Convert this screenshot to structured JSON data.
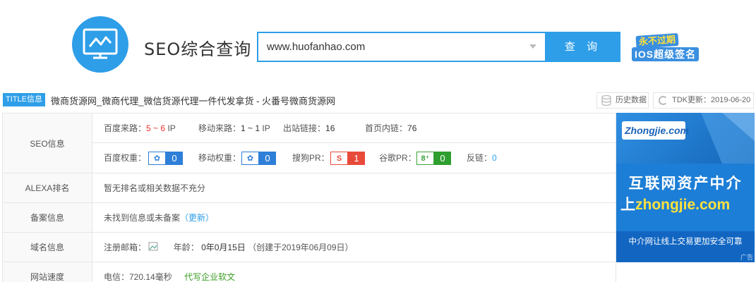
{
  "header": {
    "brand": "SEO综合查询",
    "search_value": "www.huofanhao.com",
    "search_button": "查 询",
    "ad_line1": "永不过期",
    "ad_line2": "IOS超级签名"
  },
  "title_row": {
    "tag": "TITLE信息",
    "title": "微商货源网_微商代理_微信货源代理一件代发拿货 - 火番号微商货源网",
    "history": "历史数据",
    "tdk": "TDK更新：2019-06-20"
  },
  "seo": {
    "label": "SEO信息",
    "baidu_traffic_k": "百度来路：",
    "baidu_traffic_v": "5 ~ 6",
    "baidu_traffic_unit": " IP",
    "mobile_traffic_k": "移动来路：",
    "mobile_traffic_v": "1 ~ 1",
    "mobile_traffic_unit": " IP",
    "outlinks_k": "出站链接：",
    "outlinks_v": "16",
    "innerlinks_k": "首页内链：",
    "innerlinks_v": "76",
    "baidu_weight_k": "百度权重：",
    "baidu_weight_v": "0",
    "mobile_weight_k": "移动权重：",
    "mobile_weight_v": "0",
    "sogou_pr_k": "搜狗PR：",
    "sogou_pr_v": "1",
    "google_pr_k": "谷歌PR：",
    "google_pr_v": "0",
    "backlinks_k": "反链：",
    "backlinks_v": "0"
  },
  "alexa": {
    "label": "ALEXA排名",
    "value": "暂无排名或相关数据不充分"
  },
  "beian": {
    "label": "备案信息",
    "value": "未找到信息或未备案",
    "link": "（更新）"
  },
  "domain": {
    "label": "域名信息",
    "email_k": "注册邮箱：",
    "age_k": "年龄：",
    "age_v": "0年0月15日",
    "created": "（创建于2019年06月09日）"
  },
  "speed": {
    "label": "网站速度",
    "telecom": "电信：720.14毫秒",
    "link": "代写企业软文"
  },
  "side_ad": {
    "logo": "Zhongjie.com",
    "line1": "互联网资产中介",
    "line2_a": "上",
    "line2_b": "zhongjie.com",
    "bottom": "中介网让线上交易更加安全可靠",
    "tag": "广告"
  }
}
